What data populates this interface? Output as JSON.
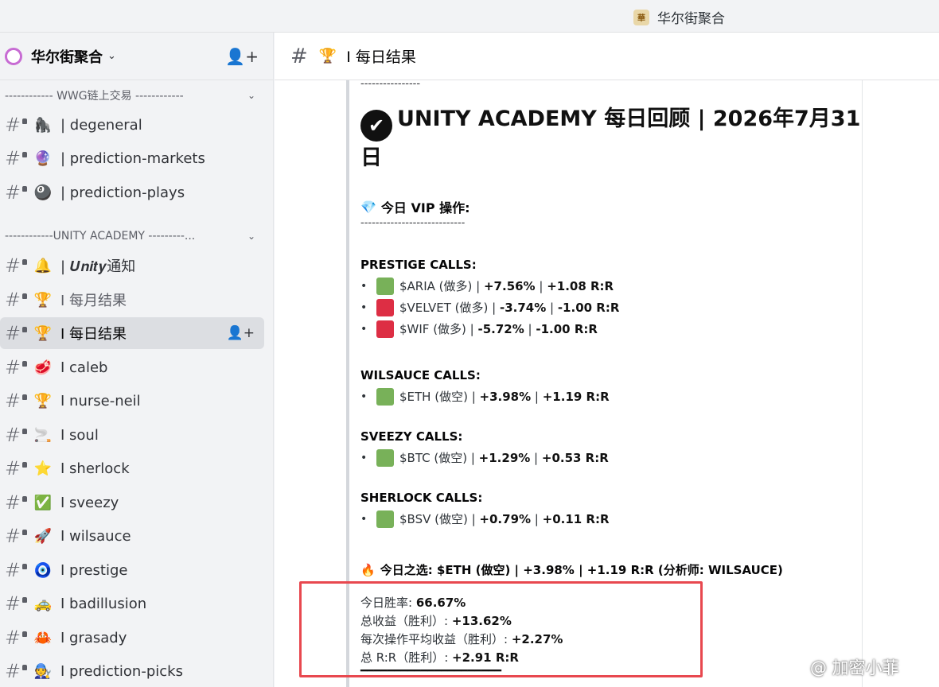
{
  "window": {
    "app_title": "华尔街聚合",
    "app_icon_text": "華"
  },
  "server": {
    "name": "华尔街聚合"
  },
  "categories": [
    {
      "label": "------------ WWG链上交易 ------------"
    },
    {
      "label": "------------UNITY ACADEMY ---------..."
    }
  ],
  "channels": [
    {
      "emoji": "🦍",
      "label": "| degeneral"
    },
    {
      "emoji": "🔮",
      "label": "| prediction-markets"
    },
    {
      "emoji": "🎱",
      "label": "| prediction-plays"
    },
    {
      "emoji": "🔔",
      "label": "| 𝑼𝒏𝒊𝒕𝒚通知"
    },
    {
      "emoji": "🏆",
      "label": "I 每月结果"
    },
    {
      "emoji": "🏆",
      "label": "I 每日结果"
    },
    {
      "emoji": "🥩",
      "label": "I caleb"
    },
    {
      "emoji": "🏆",
      "label": "I nurse-neil"
    },
    {
      "emoji": "🚬",
      "label": "I soul"
    },
    {
      "emoji": "⭐",
      "label": "I sherlock"
    },
    {
      "emoji": "✅",
      "label": "I sveezy"
    },
    {
      "emoji": "🚀",
      "label": "I wilsauce"
    },
    {
      "emoji": "🧿",
      "label": "I prestige"
    },
    {
      "emoji": "🚕",
      "label": "I badillusion"
    },
    {
      "emoji": "🦀",
      "label": "I grasady"
    },
    {
      "emoji": "🧑‍🔧",
      "label": "I prediction-picks"
    }
  ],
  "header": {
    "emoji": "🏆",
    "title": "I 每日结果"
  },
  "message": {
    "top_dashes": "----------------",
    "title_check": "✔",
    "title": "UNITY ACADEMY 每日回顾 | 2026年7月31日",
    "vip_emoji": "💎",
    "vip_label": "今日 VIP 操作:",
    "vip_dashes": "----------------------------",
    "sections": [
      {
        "title": "PRESTIGE CALLS:",
        "calls": [
          {
            "color": "green",
            "ticker": "$ARIA (做多)",
            "pct": "+7.56%",
            "rr": "+1.08 R:R"
          },
          {
            "color": "red",
            "ticker": "$VELVET (做多)",
            "pct": "-3.74%",
            "rr": "-1.00 R:R"
          },
          {
            "color": "red",
            "ticker": "$WIF (做多)",
            "pct": "-5.72%",
            "rr": "-1.00 R:R"
          }
        ]
      },
      {
        "title": "WILSAUCE CALLS:",
        "calls": [
          {
            "color": "green",
            "ticker": "$ETH (做空)",
            "pct": "+3.98%",
            "rr": "+1.19 R:R"
          }
        ]
      },
      {
        "title": "SVEEZY CALLS:",
        "calls": [
          {
            "color": "green",
            "ticker": "$BTC (做空)",
            "pct": "+1.29%",
            "rr": "+0.53 R:R"
          }
        ]
      },
      {
        "title": "SHERLOCK CALLS:",
        "calls": [
          {
            "color": "green",
            "ticker": "$BSV (做空)",
            "pct": "+0.79%",
            "rr": "+0.11 R:R"
          }
        ]
      }
    ],
    "pick_emoji": "🔥",
    "pick_text": "今日之选: $ETH (做空) | +3.98% | +1.19 R:R (分析师: WILSAUCE)",
    "stats": [
      {
        "label": "今日胜率: ",
        "value": "66.67%"
      },
      {
        "label": "总收益（胜利）: ",
        "value": "+13.62%"
      },
      {
        "label": "每次操作平均收益（胜利）: ",
        "value": "+2.27%"
      },
      {
        "label": "总 R:R（胜利）: ",
        "value": "+2.91 R:R"
      }
    ],
    "bottom_line": "━━━━━━━━━━━━━━━━━━━━━"
  },
  "watermark": "@ 加密小菲",
  "colors": {
    "accent_red_box": "#e8484f",
    "green": "#78b159",
    "red": "#dd2e44"
  }
}
